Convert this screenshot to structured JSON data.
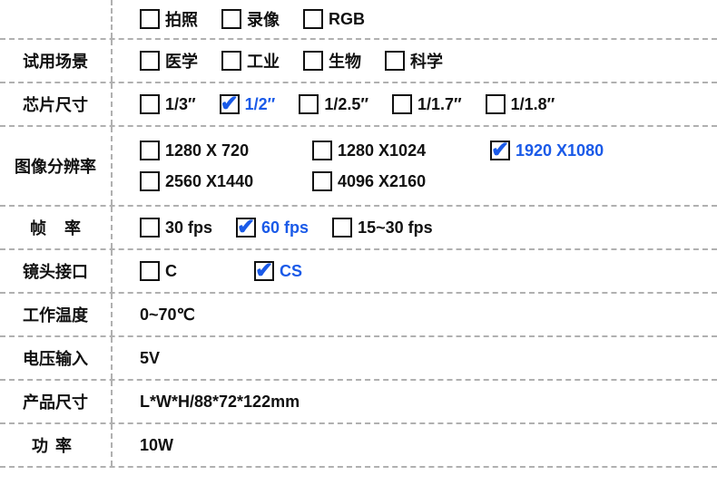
{
  "rows": [
    {
      "key": "row0",
      "label": "",
      "options": [
        {
          "text": "拍照",
          "checked": false
        },
        {
          "text": "录像",
          "checked": false
        },
        {
          "text": "RGB",
          "checked": false
        }
      ]
    },
    {
      "key": "row1",
      "label": "试用场景",
      "options": [
        {
          "text": "医学",
          "checked": false
        },
        {
          "text": "工业",
          "checked": false
        },
        {
          "text": "生物",
          "checked": false
        },
        {
          "text": "科学",
          "checked": false
        }
      ]
    },
    {
      "key": "row2",
      "label": "芯片尺寸",
      "options": [
        {
          "text": "1/3″",
          "checked": false
        },
        {
          "text": "1/2″",
          "checked": true
        },
        {
          "text": "1/2.5″",
          "checked": false
        },
        {
          "text": "1/1.7″",
          "checked": false
        },
        {
          "text": "1/1.8″",
          "checked": false
        }
      ]
    },
    {
      "key": "row3",
      "label": "图像分辨率",
      "options": [
        {
          "text": "1280 X 720",
          "checked": false
        },
        {
          "text": "1280 X1024",
          "checked": false
        },
        {
          "text": "1920 X1080",
          "checked": true
        },
        {
          "text": "2560 X1440",
          "checked": false
        },
        {
          "text": "4096 X2160",
          "checked": false
        }
      ]
    },
    {
      "key": "row4",
      "label": "帧率",
      "options": [
        {
          "text": "30 fps",
          "checked": false
        },
        {
          "text": "60 fps",
          "checked": true
        },
        {
          "text": "15~30 fps",
          "checked": false
        }
      ]
    },
    {
      "key": "row5",
      "label": "镜头接口",
      "options": [
        {
          "text": "C",
          "checked": false
        },
        {
          "text": "CS",
          "checked": true
        }
      ]
    },
    {
      "key": "row6",
      "label": "工作温度",
      "value": "0~70℃"
    },
    {
      "key": "row7",
      "label": "电压输入",
      "value": "5V"
    },
    {
      "key": "row8",
      "label": "产品尺寸",
      "value": "L*W*H/88*72*122mm"
    },
    {
      "key": "row9",
      "label": "功率",
      "value": "10W"
    }
  ]
}
